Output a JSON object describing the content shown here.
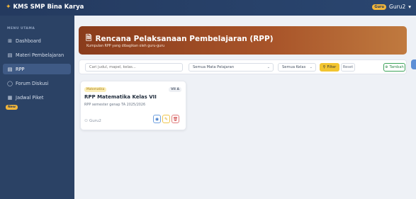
{
  "header": {
    "brand": "KMS SMP Bina Karya",
    "role_badge": "Guru",
    "user_name": "Guru2",
    "caret": "▾"
  },
  "sidebar": {
    "section_title": "MENU UTAMA",
    "items": [
      {
        "label": "Dashboard",
        "icon": "dashboard-icon"
      },
      {
        "label": "Materi Pembelajaran",
        "icon": "document-icon"
      },
      {
        "label": "RPP",
        "icon": "document-icon"
      },
      {
        "label": "Forum Diskusi",
        "icon": "chat-icon"
      },
      {
        "label": "Jadwal Piket",
        "icon": "calendar-icon"
      }
    ],
    "new_badge": "New"
  },
  "hero": {
    "title": "Rencana Pelaksanaan Pembelajaran (RPP)",
    "subtitle": "Kumpulan RPP yang dibagikan oleh guru-guru"
  },
  "filters": {
    "search_placeholder": "Cari judul, mapel, kelas...",
    "subject_select": "Semua Mata Pelajaran",
    "class_select": "Semua Kelas",
    "filter_label": "Filter",
    "reset_label": "Reset",
    "add_label": "Tambah"
  },
  "cards": [
    {
      "subject": "Matematika",
      "class": "VII A",
      "title": "RPP Matematika Kelas VII",
      "description": "RPP semester genap TA 2025/2026",
      "author": "Guru2"
    }
  ],
  "colors": {
    "topbar": "#243a5f",
    "sidebar": "#2b4265",
    "hero": "#a9552a",
    "accent": "#f2c531"
  }
}
